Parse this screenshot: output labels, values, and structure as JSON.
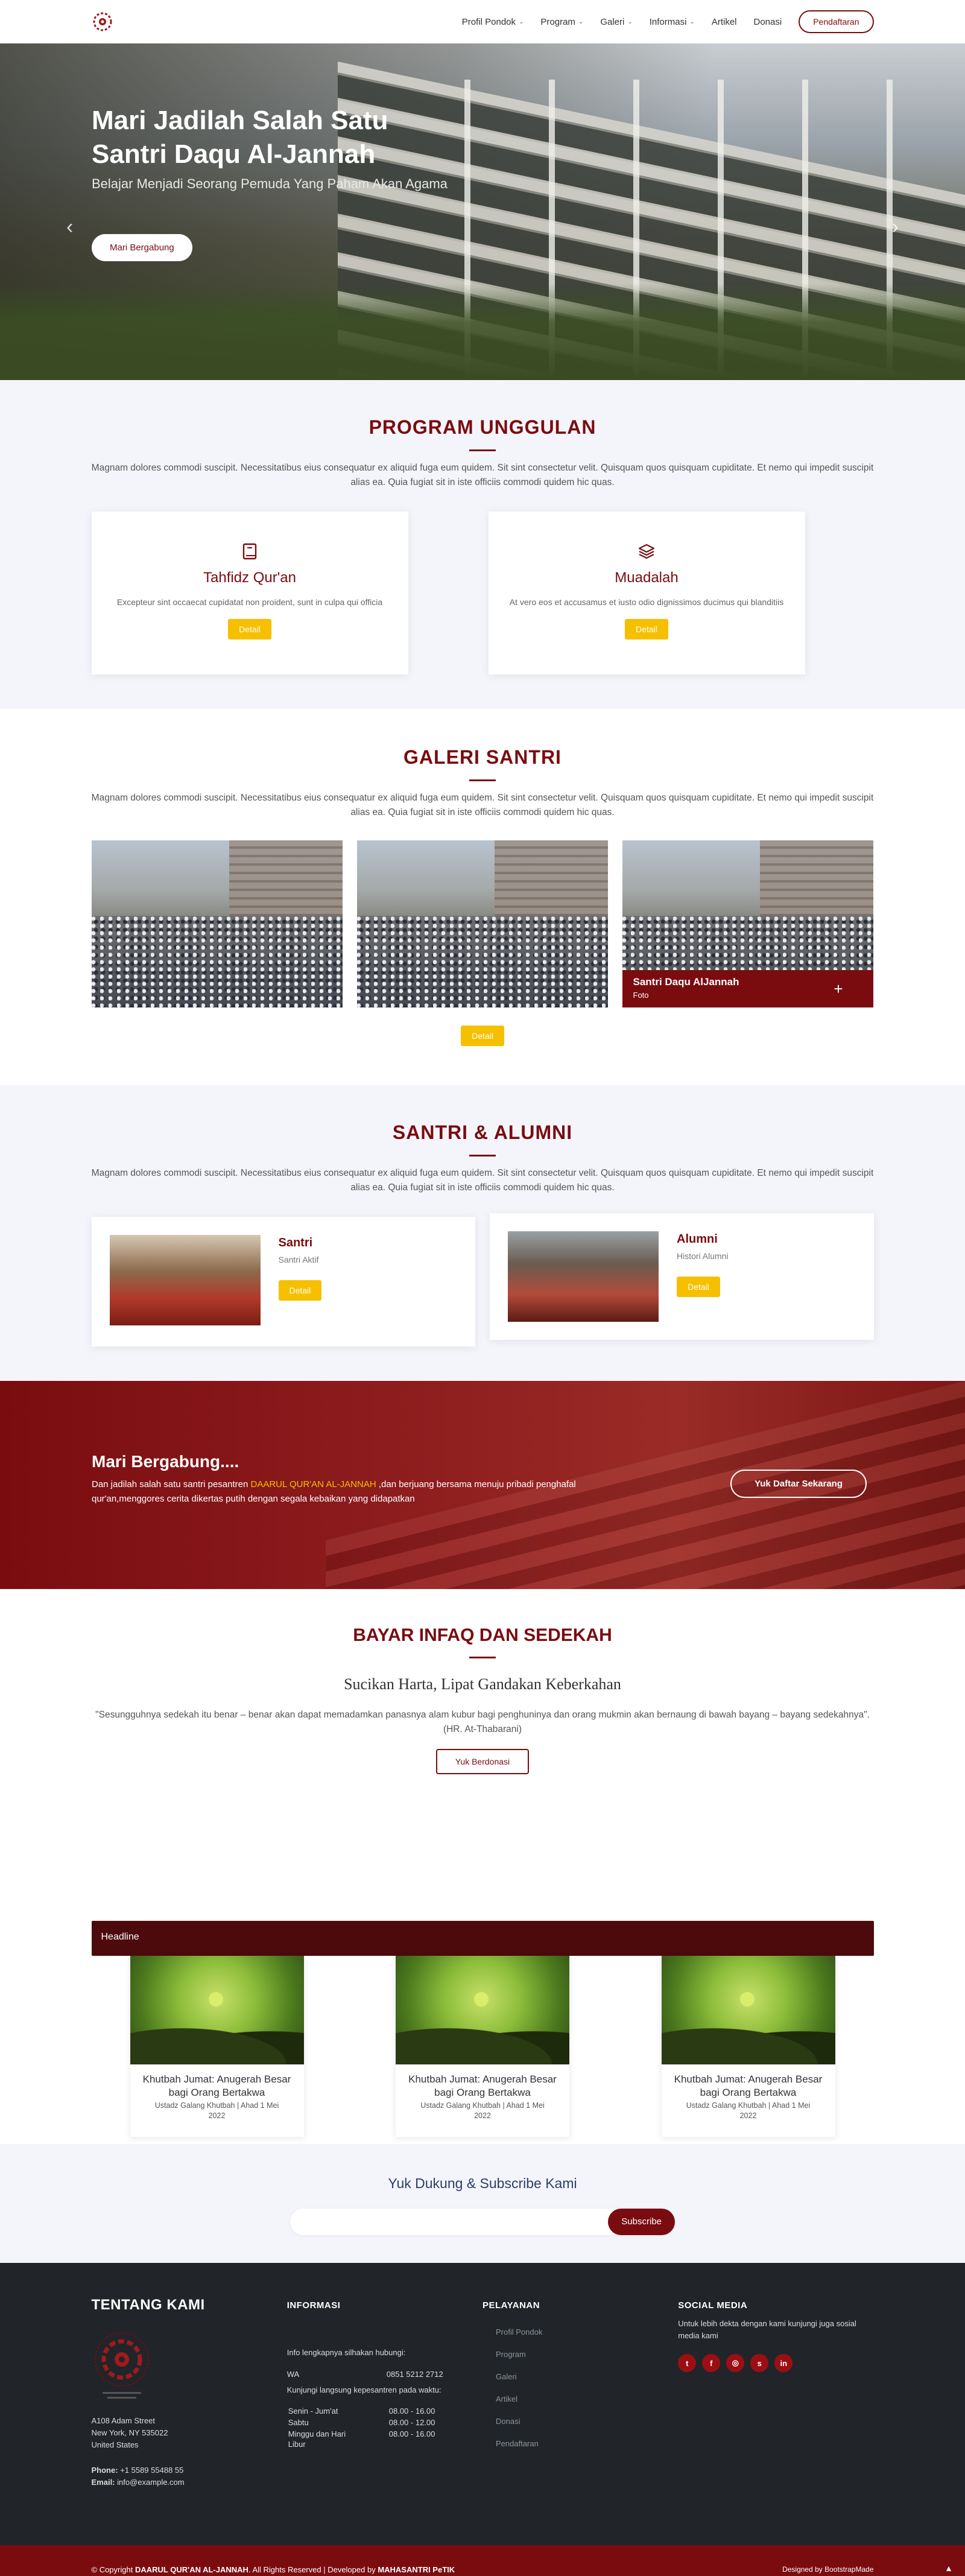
{
  "nav": {
    "items": [
      {
        "label": "Profil Pondok",
        "dropdown": true
      },
      {
        "label": "Program",
        "dropdown": true
      },
      {
        "label": "Galeri",
        "dropdown": true
      },
      {
        "label": "Informasi",
        "dropdown": true
      },
      {
        "label": "Artikel",
        "dropdown": false
      },
      {
        "label": "Donasi",
        "dropdown": false
      }
    ],
    "cta": "Pendaftaran"
  },
  "hero": {
    "title": "Mari Jadilah Salah Satu Santri Daqu Al-Jannah",
    "subtitle": "Belajar Menjadi Seorang Pemuda Yang Paham Akan Agama",
    "button": "Mari Bergabung"
  },
  "program": {
    "title": "PROGRAM UNGGULAN",
    "desc": "Magnam dolores commodi suscipit. Necessitatibus eius consequatur ex aliquid fuga eum quidem. Sit sint consectetur velit. Quisquam quos quisquam cupiditate. Et nemo qui impedit suscipit alias ea. Quia fugiat sit in iste officiis commodi quidem hic quas.",
    "cards": [
      {
        "name": "Tahfidz Qur'an",
        "text": "Excepteur sint occaecat cupidatat non proident, sunt in culpa qui officia",
        "button": "Detail",
        "icon": "book-icon"
      },
      {
        "name": "Muadalah",
        "text": "At vero eos et accusamus et iusto odio dignissimos ducimus qui blanditiis",
        "button": "Detail",
        "icon": "layers-icon"
      }
    ]
  },
  "galeri": {
    "title": "GALERI SANTRI",
    "desc": "Magnam dolores commodi suscipit. Necessitatibus eius consequatur ex aliquid fuga eum quidem. Sit sint consectetur velit. Quisquam quos quisquam cupiditate. Et nemo qui impedit suscipit alias ea. Quia fugiat sit in iste officiis commodi quidem hic quas.",
    "overlay_title": "Santri Daqu AlJannah",
    "overlay_sub": "Foto",
    "button": "Detail"
  },
  "alumni": {
    "title": "SANTRI & ALUMNI",
    "desc": "Magnam dolores commodi suscipit. Necessitatibus eius consequatur ex aliquid fuga eum quidem. Sit sint consectetur velit. Quisquam quos quisquam cupiditate. Et nemo qui impedit suscipit alias ea. Quia fugiat sit in iste officiis commodi quidem hic quas.",
    "cards": [
      {
        "name": "Santri",
        "sub": "Santri Aktif",
        "button": "Detail"
      },
      {
        "name": "Alumni",
        "sub": "Histori Alumni",
        "button": "Detail"
      }
    ]
  },
  "join": {
    "title": "Mari Bergabung....",
    "text_before": "Dan jadilah salah satu santri pesantren ",
    "highlight": "DAARUL QUR'AN AL-JANNAH",
    "text_after": " ,dan berjuang bersama menuju pribadi penghafal qur'an,menggores cerita dikertas putih dengan segala kebaikan yang didapatkan",
    "button": "Yuk Daftar Sekarang"
  },
  "infaq": {
    "title": "BAYAR INFAQ DAN SEDEKAH",
    "subtitle": "Sucikan Harta, Lipat Gandakan Keberkahan",
    "quote": "\"Sesungguhnya sedekah itu benar – benar akan dapat memadamkan panasnya alam kubur bagi penghuninya dan orang mukmin akan bernaung di bawah bayang – bayang sedekahnya\". (HR. At-Thabarani)",
    "button": "Yuk Berdonasi"
  },
  "news": {
    "headline": "Headline",
    "items": [
      {
        "title": "Khutbah Jumat: Anugerah Besar bagi Orang Bertakwa",
        "meta": "Ustadz Galang Khutbah | Ahad 1 Mei 2022"
      },
      {
        "title": "Khutbah Jumat: Anugerah Besar bagi Orang Bertakwa",
        "meta": "Ustadz Galang Khutbah | Ahad 1 Mei 2022"
      },
      {
        "title": "Khutbah Jumat: Anugerah Besar bagi Orang Bertakwa",
        "meta": "Ustadz Galang Khutbah | Ahad 1 Mei 2022"
      }
    ]
  },
  "subscribe": {
    "title": "Yuk Dukung & Subscribe Kami",
    "placeholder": "",
    "button": "Subscribe"
  },
  "footer": {
    "about_title": "TENTANG KAMI",
    "address1": "A108 Adam Street",
    "address2": "New York, NY 535022",
    "address3": "United States",
    "phone_label": "Phone:",
    "phone": "+1 5589 55488 55",
    "email_label": "Email:",
    "email": "info@example.com",
    "info_title": "INFORMASI",
    "info_text": "Info lengkapnya silhakan hubungi:",
    "wa_label": "WA",
    "wa_number": "0851 5212 2712",
    "visit_text": "Kunjungi langsung kepesantren pada waktu:",
    "hours": [
      {
        "day": "Senin - Jum'at",
        "time": "08.00 - 16.00"
      },
      {
        "day": "Sabtu",
        "time": "08.00 - 12.00"
      },
      {
        "day": "Minggu dan Hari Libur",
        "time": "08.00 - 16.00"
      }
    ],
    "service_title": "PELAYANAN",
    "services": [
      "Profil Pondok",
      "Program",
      "Galeri",
      "Artikel",
      "Donasi",
      "Pendaftaran"
    ],
    "social_title": "SOCIAL MEDIA",
    "social_text": "Untuk lebih dekta dengan kami kunjungi juga sosial media kami",
    "socials": [
      "t",
      "f",
      "ig",
      "s",
      "in"
    ]
  },
  "copyright": {
    "prefix": "© Copyright ",
    "brand": "DAARUL QUR'AN AL-JANNAH",
    "middle": ". All Rights Reserved | Developed by ",
    "dev": "MAHASANTRI PeTIK",
    "right_prefix": "Designed by ",
    "right_brand": "BootstrapMade"
  },
  "colors": {
    "maroon": "#7a0c10",
    "yellow": "#f6c000",
    "dark": "#212529"
  }
}
